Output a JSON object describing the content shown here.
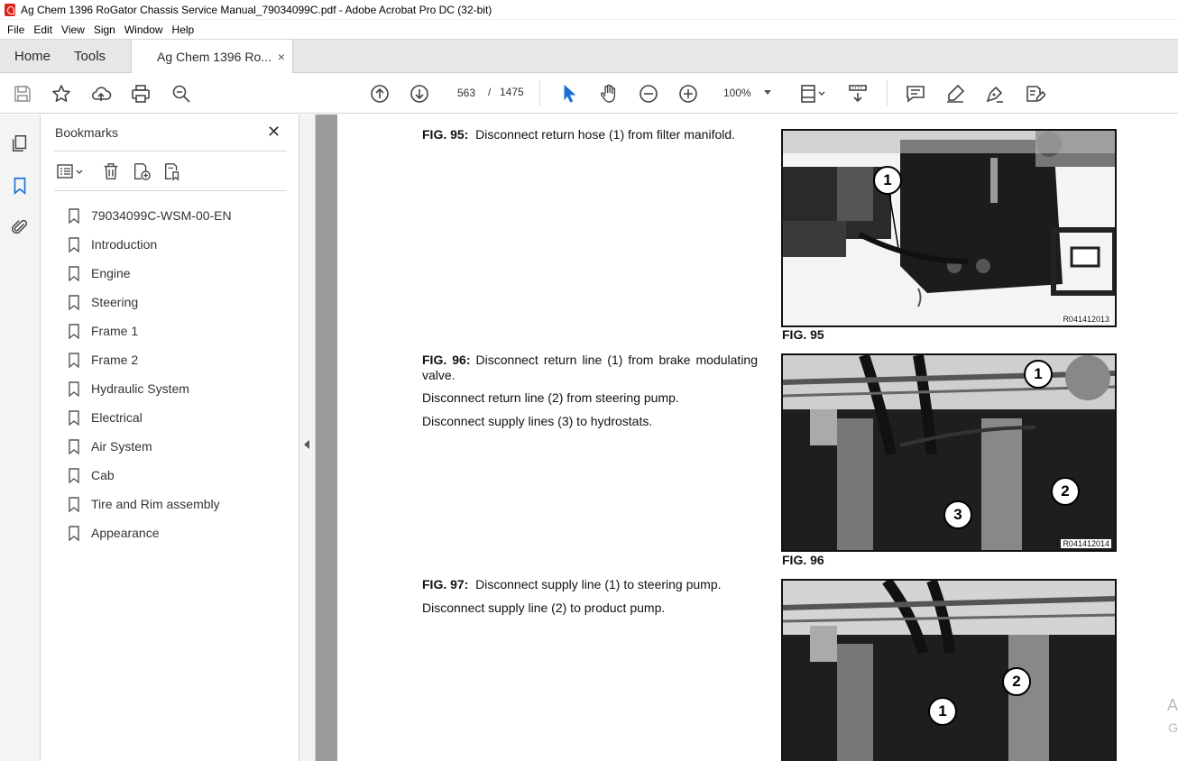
{
  "window": {
    "title": "Ag Chem 1396 RoGator Chassis Service Manual_79034099C.pdf - Adobe Acrobat Pro DC (32-bit)"
  },
  "menu": [
    "File",
    "Edit",
    "View",
    "Sign",
    "Window",
    "Help"
  ],
  "tabs": {
    "home": "Home",
    "tools": "Tools",
    "document": "Ag Chem 1396 Ro...",
    "close": "×"
  },
  "toolbar": {
    "current_page": "563",
    "separator": "/",
    "total_pages": "1475",
    "zoom": "100%",
    "icons": [
      "save-icon",
      "star-icon",
      "upload-icon",
      "print-icon",
      "find-icon",
      "page-up-icon",
      "page-down-icon",
      "select-cursor-icon",
      "hand-icon",
      "zoom-out-icon",
      "zoom-in-icon",
      "fit-page-icon",
      "scroll-mode-icon",
      "comment-icon",
      "highlight-icon",
      "sign-icon",
      "fill-sign-icon"
    ]
  },
  "bookmarks": {
    "title": "Bookmarks",
    "close": "✕",
    "items": [
      "79034099C-WSM-00-EN",
      "Introduction",
      "Engine",
      "Steering",
      "Frame 1",
      "Frame 2",
      "Hydraulic System",
      "Electrical",
      "Air System",
      "Cab",
      "Tire and Rim assembly",
      "Appearance"
    ]
  },
  "document": {
    "fig95": {
      "label": "FIG. 95:",
      "text": "Disconnect return hose (1) from filter manifold.",
      "caption": "FIG. 95",
      "code": "R041412013",
      "callouts": [
        "1"
      ]
    },
    "fig96": {
      "label": "FIG. 96:",
      "line1": "Disconnect return line (1) from brake modulating valve.",
      "line2": "Disconnect return line (2) from steering pump.",
      "line3": "Disconnect supply lines (3) to hydrostats.",
      "caption": "FIG. 96",
      "code": "R041412014",
      "callouts": [
        "1",
        "2",
        "3"
      ]
    },
    "fig97": {
      "label": "FIG. 97:",
      "line1": "Disconnect supply line (1) to steering pump.",
      "line2": "Disconnect supply line (2) to product pump.",
      "callouts": [
        "1",
        "2"
      ]
    },
    "edge_text1": "A",
    "edge_text2": "G"
  }
}
